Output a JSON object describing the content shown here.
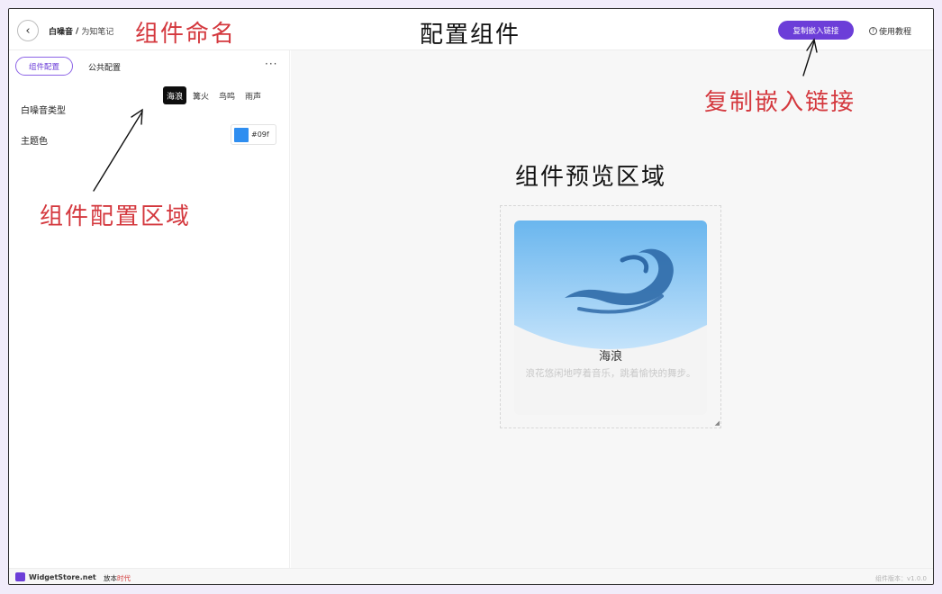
{
  "header": {
    "widget_name": "白噪音",
    "separator": "/",
    "org": "为知笔记",
    "copy_embed_label": "复制嵌入链接",
    "help_label": "使用教程",
    "help_icon": "?"
  },
  "sidebar": {
    "tabs": [
      {
        "label": "组件配置",
        "active": true
      },
      {
        "label": "公共配置",
        "active": false
      }
    ],
    "more_label": "···",
    "settings": {
      "sound_type_label": "白噪音类型",
      "sound_types": [
        "海浪",
        "篝火",
        "鸟鸣",
        "雨声"
      ],
      "selected_sound": "海浪",
      "theme_label": "主题色",
      "theme_color": "#2f8ef0",
      "theme_hex_display": "#09f"
    }
  },
  "preview": {
    "title": "海浪",
    "description": "浪花悠闲地哼着音乐，跳着愉快的舞步。",
    "wave_icon": "wave-icon",
    "gradient_top": "#6ab6ee",
    "gradient_bottom": "#c4e3fb"
  },
  "footer": {
    "brand": "WidgetStore.net",
    "partner_prefix": "放本",
    "partner_suffix": "时代",
    "version": "组件版本：v1.0.0"
  },
  "annotations": {
    "widget_naming": "组件命名",
    "configure_widget": "配置组件",
    "copy_embed_link": "复制嵌入链接",
    "config_area": "组件配置区域",
    "preview_area": "组件预览区域"
  },
  "colors": {
    "accent": "#6c3ed8",
    "annotation_red": "#d4383e"
  }
}
